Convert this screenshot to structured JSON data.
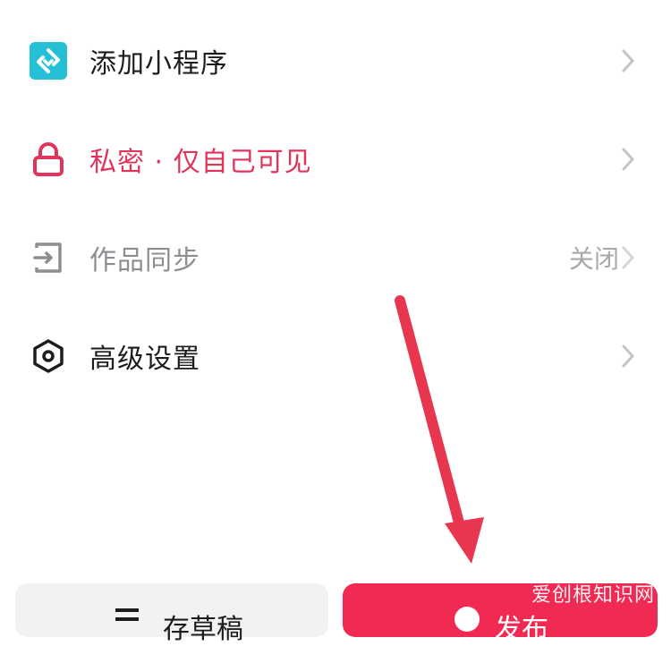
{
  "menu": {
    "items": [
      {
        "id": "mini-program",
        "label": "添加小程序",
        "value": "",
        "icon": "mini-program-icon",
        "color": "#25c0d6"
      },
      {
        "id": "privacy",
        "label": "私密 · 仅自己可见",
        "value": "",
        "icon": "lock-icon",
        "color": "#e0345a"
      },
      {
        "id": "sync",
        "label": "作品同步",
        "value": "关闭",
        "icon": "exit-sync-icon",
        "color": "#8d8d92"
      },
      {
        "id": "advanced",
        "label": "高级设置",
        "value": "",
        "icon": "hexagon-settings-icon",
        "color": "#1c1c1e"
      }
    ]
  },
  "bottom": {
    "draft_label": "存草稿",
    "publish_label": "发布"
  },
  "watermark": "爱创根知识网",
  "colors": {
    "accent": "#f02a52",
    "arrow": "#e8364f",
    "chevron": "#c4c4c8"
  }
}
